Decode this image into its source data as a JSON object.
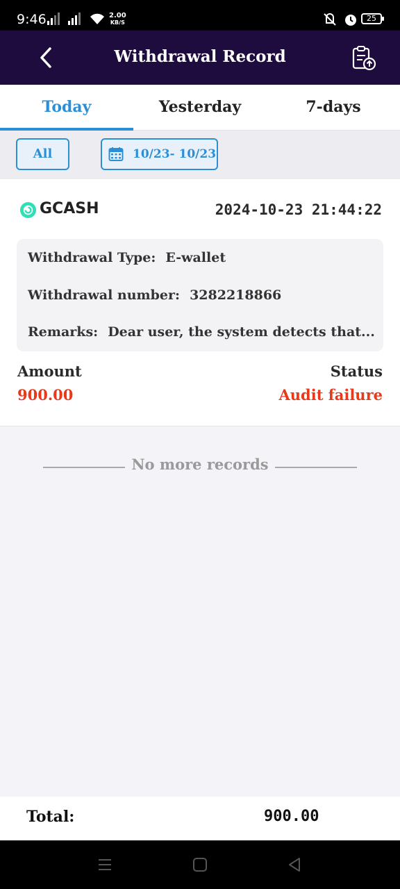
{
  "status_bar": {
    "time": "9:46",
    "net_speed_value": "2.00",
    "net_speed_unit": "KB/S",
    "battery": "25"
  },
  "header": {
    "title": "Withdrawal Record",
    "back_icon": "chevron-left-icon",
    "record_icon": "clipboard-upload-icon"
  },
  "tabs": [
    {
      "label": "Today",
      "active": true
    },
    {
      "label": "Yesterday",
      "active": false
    },
    {
      "label": "7-days",
      "active": false
    }
  ],
  "filter": {
    "all_label": "All",
    "date_range": "10/23- 10/23",
    "date_icon": "calendar-icon"
  },
  "record": {
    "method": "GCASH",
    "datetime": "2024-10-23 21:44:22",
    "type_label": "Withdrawal Type:",
    "type_value": "E-wallet",
    "number_label": "Withdrawal number:",
    "number_value": "3282218866",
    "remarks_label": "Remarks:",
    "remarks_value": "Dear user, the system detects that...",
    "amount_label": "Amount",
    "amount_value": "900.00",
    "status_label": "Status",
    "status_value": "Audit failure"
  },
  "list_footer": "No more records",
  "total": {
    "label": "Total:",
    "value": "900.00"
  },
  "colors": {
    "header_bg": "#1f0c3e",
    "accent": "#2b8fd6",
    "status_fail": "#e8391a"
  }
}
